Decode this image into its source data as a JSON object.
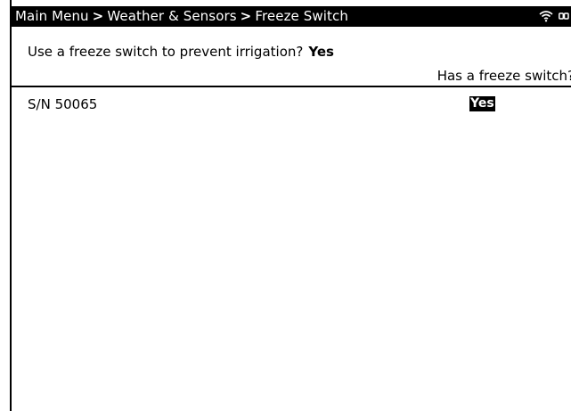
{
  "header": {
    "breadcrumb": [
      {
        "label": "Main Menu"
      },
      {
        "label": "Weather & Sensors"
      },
      {
        "label": "Freeze Switch"
      }
    ],
    "separator": ">",
    "icons": [
      "wifi-icon",
      "battery-icon"
    ]
  },
  "question": {
    "label": "Use a freeze switch to prevent irrigation?",
    "value": "Yes"
  },
  "table": {
    "column_header": "Has a freeze switch?",
    "rows": [
      {
        "serial": "S/N 50065",
        "has_freeze_switch": "Yes"
      }
    ]
  },
  "colors": {
    "header_bg": "#000000",
    "header_text": "#ffffff",
    "background": "#ffffff",
    "selected_bg": "#000000",
    "selected_text": "#ffffff"
  }
}
